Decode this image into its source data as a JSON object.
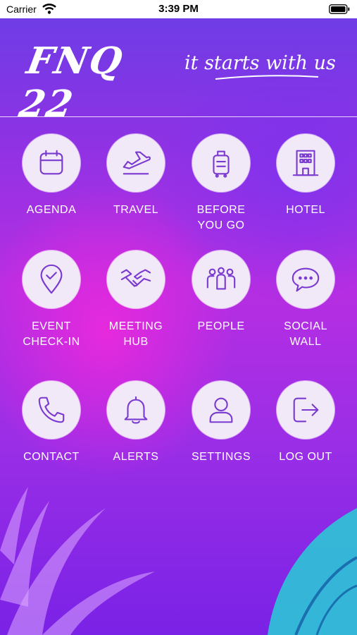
{
  "status_bar": {
    "carrier": "Carrier",
    "time": "3:39 PM"
  },
  "header": {
    "logo": "FNQ 22",
    "tagline": "it starts with us"
  },
  "colors": {
    "icon_stroke": "#7a3ad0",
    "circle_fill": "#f1e9f8",
    "bg_purple": "#7a2ae0",
    "bg_magenta": "#f028dc",
    "leaf_teal": "#2cc7d6"
  },
  "menu": [
    {
      "label": "AGENDA",
      "icon": "calendar-icon"
    },
    {
      "label": "TRAVEL",
      "icon": "plane-icon"
    },
    {
      "label": "BEFORE YOU GO",
      "icon": "luggage-icon"
    },
    {
      "label": "HOTEL",
      "icon": "hotel-icon"
    },
    {
      "label": "EVENT CHECK-IN",
      "icon": "location-check-icon"
    },
    {
      "label": "MEETING HUB",
      "icon": "handshake-icon"
    },
    {
      "label": "PEOPLE",
      "icon": "people-icon"
    },
    {
      "label": "SOCIAL WALL",
      "icon": "chat-bubble-icon"
    },
    {
      "label": "CONTACT",
      "icon": "phone-icon"
    },
    {
      "label": "ALERTS",
      "icon": "bell-icon"
    },
    {
      "label": "SETTINGS",
      "icon": "user-icon"
    },
    {
      "label": "LOG OUT",
      "icon": "logout-icon"
    }
  ]
}
